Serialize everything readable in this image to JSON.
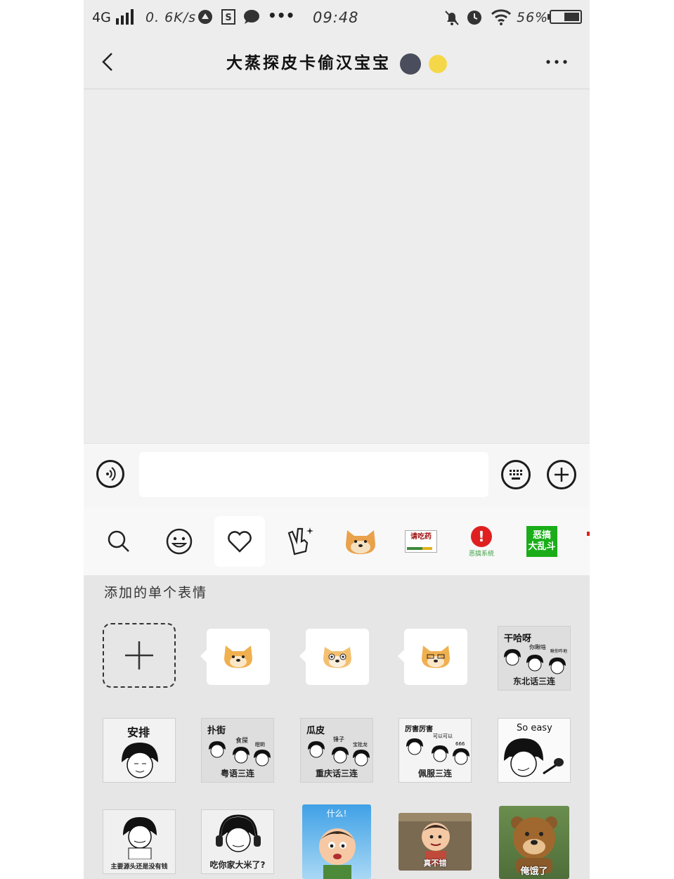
{
  "status_bar": {
    "network": "4G",
    "speed": "0. 6K/s",
    "time": "09:48",
    "battery": "56%"
  },
  "nav": {
    "title": "大蒸探皮卡偷汉宝宝",
    "title_emojis": [
      "🌚",
      "🌝"
    ]
  },
  "input_bar": {
    "message_value": "",
    "message_placeholder": ""
  },
  "emoji_tabs": [
    {
      "name": "search",
      "icon": "search-icon"
    },
    {
      "name": "emoji",
      "icon": "smiley-icon"
    },
    {
      "name": "favorites",
      "icon": "heart-icon",
      "active": true
    },
    {
      "name": "custom",
      "icon": "peace-hand-icon"
    },
    {
      "name": "doge-sticker",
      "icon": "doge-icon"
    },
    {
      "name": "qingchiyao",
      "label": "请吃药"
    },
    {
      "name": "egao-system",
      "label": "恶搞系统"
    },
    {
      "name": "egao-luandou",
      "label": "恶搞\n大乱斗"
    }
  ],
  "panel": {
    "section_title": "添加的单个表情",
    "stickers": [
      {
        "top": "干哈呀",
        "mid": "你瞅啥",
        "mid2": "瞅你咋地",
        "bottom": "东北话三连"
      },
      {
        "top": "安排",
        "bottom": ""
      },
      {
        "top": "扑街",
        "mid": "食屎",
        "mid2": "瞪啲",
        "bottom": "粤语三连"
      },
      {
        "top": "瓜皮",
        "mid": "锤子",
        "mid2": "宝批龙",
        "bottom": "重庆话三连"
      },
      {
        "top": "厉害厉害",
        "mid": "可以可以",
        "mid2": "666",
        "bottom": "佩服三连"
      },
      {
        "top": "So easy",
        "bottom": ""
      },
      {
        "top": "",
        "bottom": "主要源头还是没有钱"
      },
      {
        "top": "",
        "bottom": "吃你家大米了?"
      },
      {
        "top": "什么!",
        "bottom": ""
      },
      {
        "top": "",
        "bottom": "真不错"
      },
      {
        "top": "",
        "bottom": "俺饿了"
      }
    ]
  },
  "colors": {
    "background": "#ededed",
    "panel": "#e6e6e6",
    "green_badge": "#1aad19",
    "red_badge": "#e02020"
  }
}
